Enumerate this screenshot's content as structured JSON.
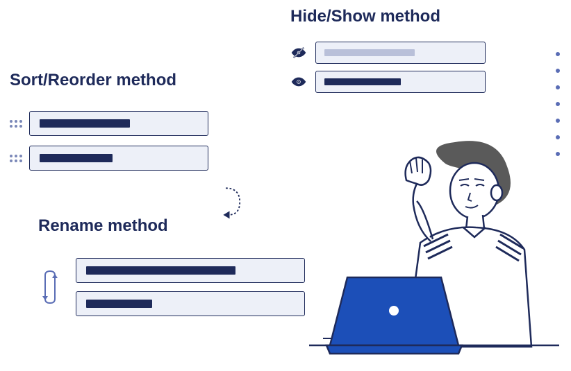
{
  "sections": {
    "hideshow": {
      "title": "Hide/Show method"
    },
    "sort": {
      "title": "Sort/Reorder method"
    },
    "rename": {
      "title": "Rename method"
    }
  },
  "colors": {
    "primary": "#1e2a5a",
    "field_bg": "#edf0f8",
    "accent_blue": "#1c4fb8",
    "muted": "#b9c0d9",
    "dot": "#5a6db5"
  }
}
